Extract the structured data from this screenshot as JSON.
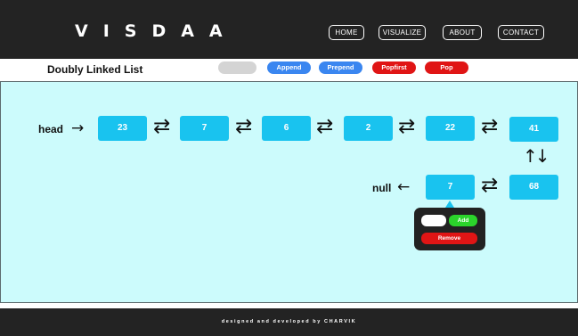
{
  "header": {
    "logo": "VISDAA",
    "nav": [
      "HOME",
      "VISUALIZE",
      "ABOUT",
      "CONTACT"
    ]
  },
  "toolbar": {
    "title": "Doubly Linked List",
    "input_value": "",
    "buttons": {
      "append": "Append",
      "prepend": "Prepend",
      "popfirst": "Popfirst",
      "pop": "Pop"
    }
  },
  "list": {
    "head_label": "head",
    "null_label": "null",
    "nodes": [
      "23",
      "7",
      "6",
      "2",
      "22",
      "41",
      "68",
      "7"
    ],
    "arrows": {
      "right": "→",
      "left": "←",
      "bidirectional": "⇄",
      "vertical": "↑↓"
    }
  },
  "popup": {
    "input_value": "",
    "add": "Add",
    "remove": "Remove"
  },
  "footer": {
    "text": "designed and developed by CHARVIK"
  },
  "colors": {
    "dark": "#232323",
    "canvas": "#ccfbfc",
    "node": "#19c3ef",
    "blue_button": "#3a86f0",
    "red_button": "#e01515",
    "green_button": "#2bd42b",
    "input_pill": "#d4d4d4"
  },
  "icons": {
    "swap": "double-arrow-icon",
    "vertical": "up-down-arrow-icon",
    "pointer": "arrow-icon"
  }
}
